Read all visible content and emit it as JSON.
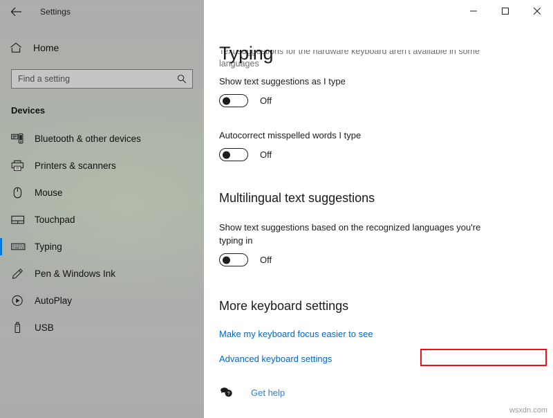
{
  "window": {
    "app_title": "Settings",
    "back_icon": "back-arrow-icon",
    "controls": {
      "minimize_label": "—",
      "maximize_label": "☐",
      "close_label": "✕"
    }
  },
  "sidebar": {
    "home": {
      "label": "Home",
      "icon": "home-icon"
    },
    "search": {
      "value": "",
      "placeholder": "Find a setting",
      "icon": "search-icon"
    },
    "category_heading": "Devices",
    "items": [
      {
        "label": "Bluetooth & other devices",
        "icon": "bluetooth-devices-icon",
        "selected": false
      },
      {
        "label": "Printers & scanners",
        "icon": "printer-icon",
        "selected": false
      },
      {
        "label": "Mouse",
        "icon": "mouse-icon",
        "selected": false
      },
      {
        "label": "Touchpad",
        "icon": "touchpad-icon",
        "selected": false
      },
      {
        "label": "Typing",
        "icon": "keyboard-icon",
        "selected": true
      },
      {
        "label": "Pen & Windows Ink",
        "icon": "pen-icon",
        "selected": false
      },
      {
        "label": "AutoPlay",
        "icon": "autoplay-icon",
        "selected": false
      },
      {
        "label": "USB",
        "icon": "usb-icon",
        "selected": false
      }
    ]
  },
  "main": {
    "page_title": "Typing",
    "clipped_note_line1": "Text suggestions for the hardware keyboard aren't available in some",
    "clipped_note_line2": "languages",
    "settings": [
      {
        "label": "Show text suggestions as I type",
        "state": "Off"
      },
      {
        "label": "Autocorrect misspelled words I type",
        "state": "Off"
      }
    ],
    "multilingual": {
      "heading": "Multilingual text suggestions",
      "label_line1": "Show text suggestions based on the recognized languages you're",
      "label_line2": "typing in",
      "state": "Off"
    },
    "more_keyboard": {
      "heading": "More keyboard settings",
      "links": [
        "Make my keyboard focus easier to see",
        "Advanced keyboard settings"
      ],
      "highlighted_link_index": 1
    },
    "get_help": {
      "label": "Get help",
      "icon": "help-bubble-icon"
    }
  },
  "watermark": "wsxdn.com",
  "colors": {
    "accent": "#0078d7",
    "link": "#0066cc",
    "highlight_border": "#ee1111",
    "sidebar_base": "#adadad"
  }
}
